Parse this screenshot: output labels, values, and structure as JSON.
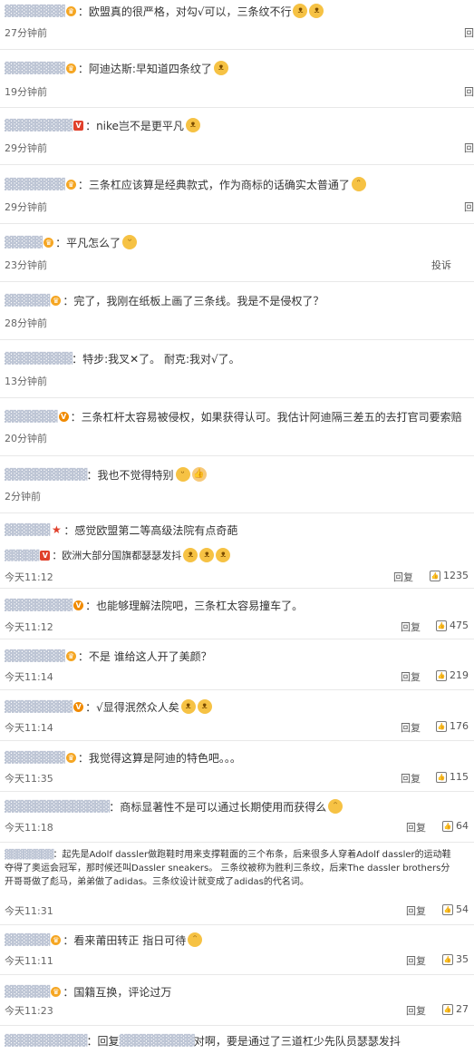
{
  "comments": [
    {
      "name": "▓▓▓▓▓▓▓▓",
      "badge": "crown",
      "text": "：欧盟真的很严格，对勾√可以，三条纹不行",
      "emoji": [
        "cat-face",
        "cat-face"
      ],
      "time": "27分钟前",
      "right": "回"
    },
    {
      "name": "▓▓▓▓▓▓▓▓",
      "badge": "crown",
      "text": "：阿迪达斯:早知道四条纹了",
      "emoji": [
        "cat-face"
      ],
      "time": "19分钟前",
      "right": "回"
    },
    {
      "name": "▓▓▓▓▓▓▓▓▓",
      "badge": "vbox",
      "text": "：nike岂不是更平凡",
      "emoji": [
        "cat-face"
      ],
      "time": "29分钟前",
      "right": "回"
    },
    {
      "name": "▓▓▓▓▓▓▓▓",
      "badge": "crown",
      "text": "：三条杠应该算是经典款式，作为商标的话确实太普通了",
      "emoji": [
        "laugh-face"
      ],
      "time": "29分钟前",
      "right": "回"
    },
    {
      "name": "▓▓▓▓▓",
      "badge": "crown",
      "text": "：平凡怎么了",
      "emoji": [
        "grin-face"
      ],
      "time": "23分钟前",
      "right": "投诉"
    },
    {
      "name": "▓▓▓▓▓▓",
      "badge": "crown",
      "text": "：完了，我刚在纸板上画了三条线。我是不是侵权了？",
      "emoji": [],
      "time": "28分钟前",
      "right": ""
    },
    {
      "name": "▓▓▓▓▓▓▓▓▓",
      "badge": "",
      "text": "：特步:我叉✕了。 耐克:我对√了。",
      "emoji": [],
      "time": "13分钟前",
      "right": ""
    },
    {
      "name": "▓▓▓▓▓▓▓",
      "badge": "v",
      "text": "：三条杠杆太容易被侵权，如果获得认可。我估计阿迪隔三差五的去打官司要索赔",
      "emoji": [],
      "time": "20分钟前",
      "right": ""
    },
    {
      "name": "▓▓▓▓▓▓▓▓▓▓▓",
      "badge": "",
      "text": "：我也不觉得特别",
      "emoji": [
        "grin-face",
        "thumb"
      ],
      "time": "2分钟前",
      "right": ""
    }
  ],
  "replies": [
    {
      "name": "▓▓▓▓▓▓",
      "badge": "star",
      "text": "：感觉欧盟第二等高级法院有点奇葩",
      "sub_name": "▓▓▓▓▓",
      "sub_badge": "vbox",
      "sub_text": "：欧洲大部分国旗都瑟瑟发抖",
      "sub_emoji": [
        "cat-face",
        "cat-face",
        "cat-face"
      ],
      "time": "今天11:12",
      "reply": "回复",
      "likes": "1235"
    },
    {
      "name": "▓▓▓▓▓▓▓▓▓",
      "badge": "v",
      "text": "：也能够理解法院吧，三条杠太容易撞车了。",
      "time": "今天11:12",
      "reply": "回复",
      "likes": "475"
    },
    {
      "name": "▓▓▓▓▓▓▓▓",
      "badge": "crown",
      "text": "：不是 谁给这人开了美颜？",
      "time": "今天11:14",
      "reply": "回复",
      "likes": "219"
    },
    {
      "name": "▓▓▓▓▓▓▓▓▓",
      "badge": "v",
      "text": "：√显得泯然众人矣",
      "emoji": [
        "cat-face",
        "cat-face"
      ],
      "time": "今天11:14",
      "reply": "回复",
      "likes": "176"
    },
    {
      "name": "▓▓▓▓▓▓▓▓",
      "badge": "crown",
      "text": "：我觉得这算是阿迪的特色吧。。。",
      "time": "今天11:35",
      "reply": "回复",
      "likes": "115"
    },
    {
      "name": "▓▓▓▓▓▓▓▓▓▓▓▓▓▓",
      "badge": "",
      "text": "：商标显著性不是可以通过长期使用而获得么",
      "emoji": [
        "laugh-face"
      ],
      "time": "今天11:18",
      "reply": "回复",
      "likes": "64"
    }
  ],
  "long_comment": {
    "name": "▓▓▓▓▓▓▓▓",
    "lines": [
      "：起先是Adolf dassler做跑鞋时用来支撑鞋面的三个布条，后来很多人穿着Adolf dassler的运动鞋",
      "夺得了奥运会冠军，那时候还叫Dassler sneakers。 三条纹被称为胜利三条纹，后来The dassler brothers分",
      "开哥哥做了彪马，弟弟做了adidas。三条纹设计就变成了adidas的代名词。"
    ],
    "time": "今天11:31",
    "reply": "回复",
    "likes": "54"
  },
  "tail_replies": [
    {
      "name": "▓▓▓▓▓▓",
      "badge": "crown",
      "text": "：看来莆田转正 指日可待",
      "emoji": [
        "laugh-face"
      ],
      "time": "今天11:11",
      "reply": "回复",
      "likes": "35"
    },
    {
      "name": "▓▓▓▓▓▓",
      "badge": "crown",
      "text": "：国籍互换，评论过万",
      "time": "今天11:23",
      "reply": "回复",
      "likes": "27"
    }
  ],
  "bottom": {
    "name": "▓▓▓▓▓▓▓▓▓▓▓",
    "text": "：回复",
    "mention": "▓▓▓▓▓▓▓▓▓▓",
    "tail": "对啊，要是通过了三道杠少先队员瑟瑟发抖"
  }
}
